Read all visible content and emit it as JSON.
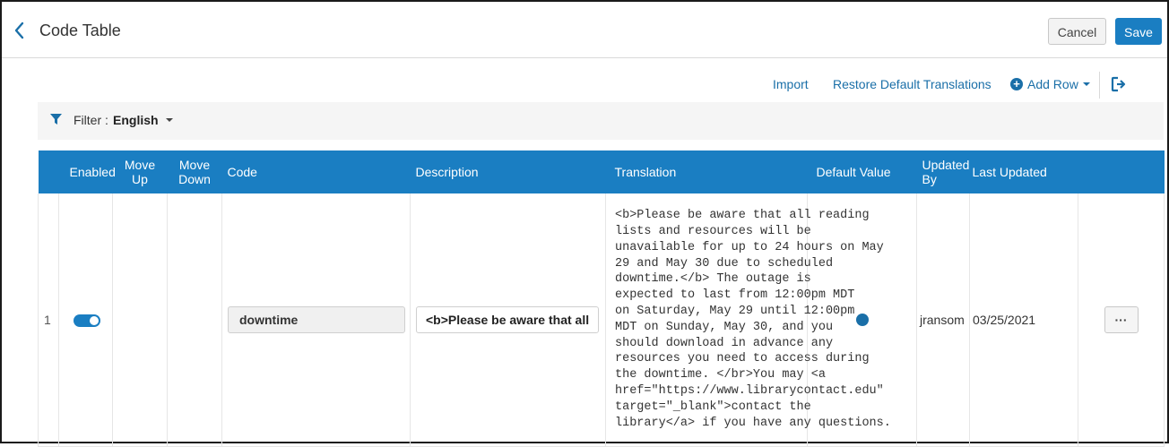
{
  "header": {
    "title": "Code Table",
    "cancel_label": "Cancel",
    "save_label": "Save"
  },
  "actions": {
    "import_label": "Import",
    "restore_label": "Restore Default Translations",
    "add_row_label": "Add Row"
  },
  "filter": {
    "label": "Filter :",
    "value": "English"
  },
  "table": {
    "columns": {
      "enabled": "Enabled",
      "move_up": "Move Up",
      "move_down": "Move Down",
      "code": "Code",
      "description": "Description",
      "translation": "Translation",
      "default_value": "Default Value",
      "updated_by": "Updated By",
      "last_updated": "Last Updated"
    },
    "rows": [
      {
        "index": "1",
        "enabled": true,
        "code": "downtime",
        "description": "<b>Please be aware that all re",
        "translation": "<b>Please be aware that all reading\nlists and resources will be\nunavailable for up to 24 hours on May\n29 and May 30 due to scheduled\ndowntime.</b> The outage is\nexpected to last from 12:00pm MDT\non Saturday, May 29 until 12:00pm\nMDT on Sunday, May 30, and you\nshould download in advance any\nresources you need to access during\nthe downtime. </br>You may <a\nhref=\"https://www.librarycontact.edu\"\ntarget=\"_blank\">contact the\nlibrary</a> if you have any questions.",
        "default_value": true,
        "updated_by": "jransom",
        "last_updated": "03/25/2021",
        "more_label": "···"
      }
    ]
  },
  "icons": {
    "back": "chevron-left-icon",
    "plus": "plus-circle-icon",
    "caret": "caret-down-icon",
    "export": "export-icon",
    "filter": "filter-icon"
  },
  "colors": {
    "primary": "#1a7ec2",
    "link": "#1a6fa8",
    "header_text": "#ffffff"
  }
}
